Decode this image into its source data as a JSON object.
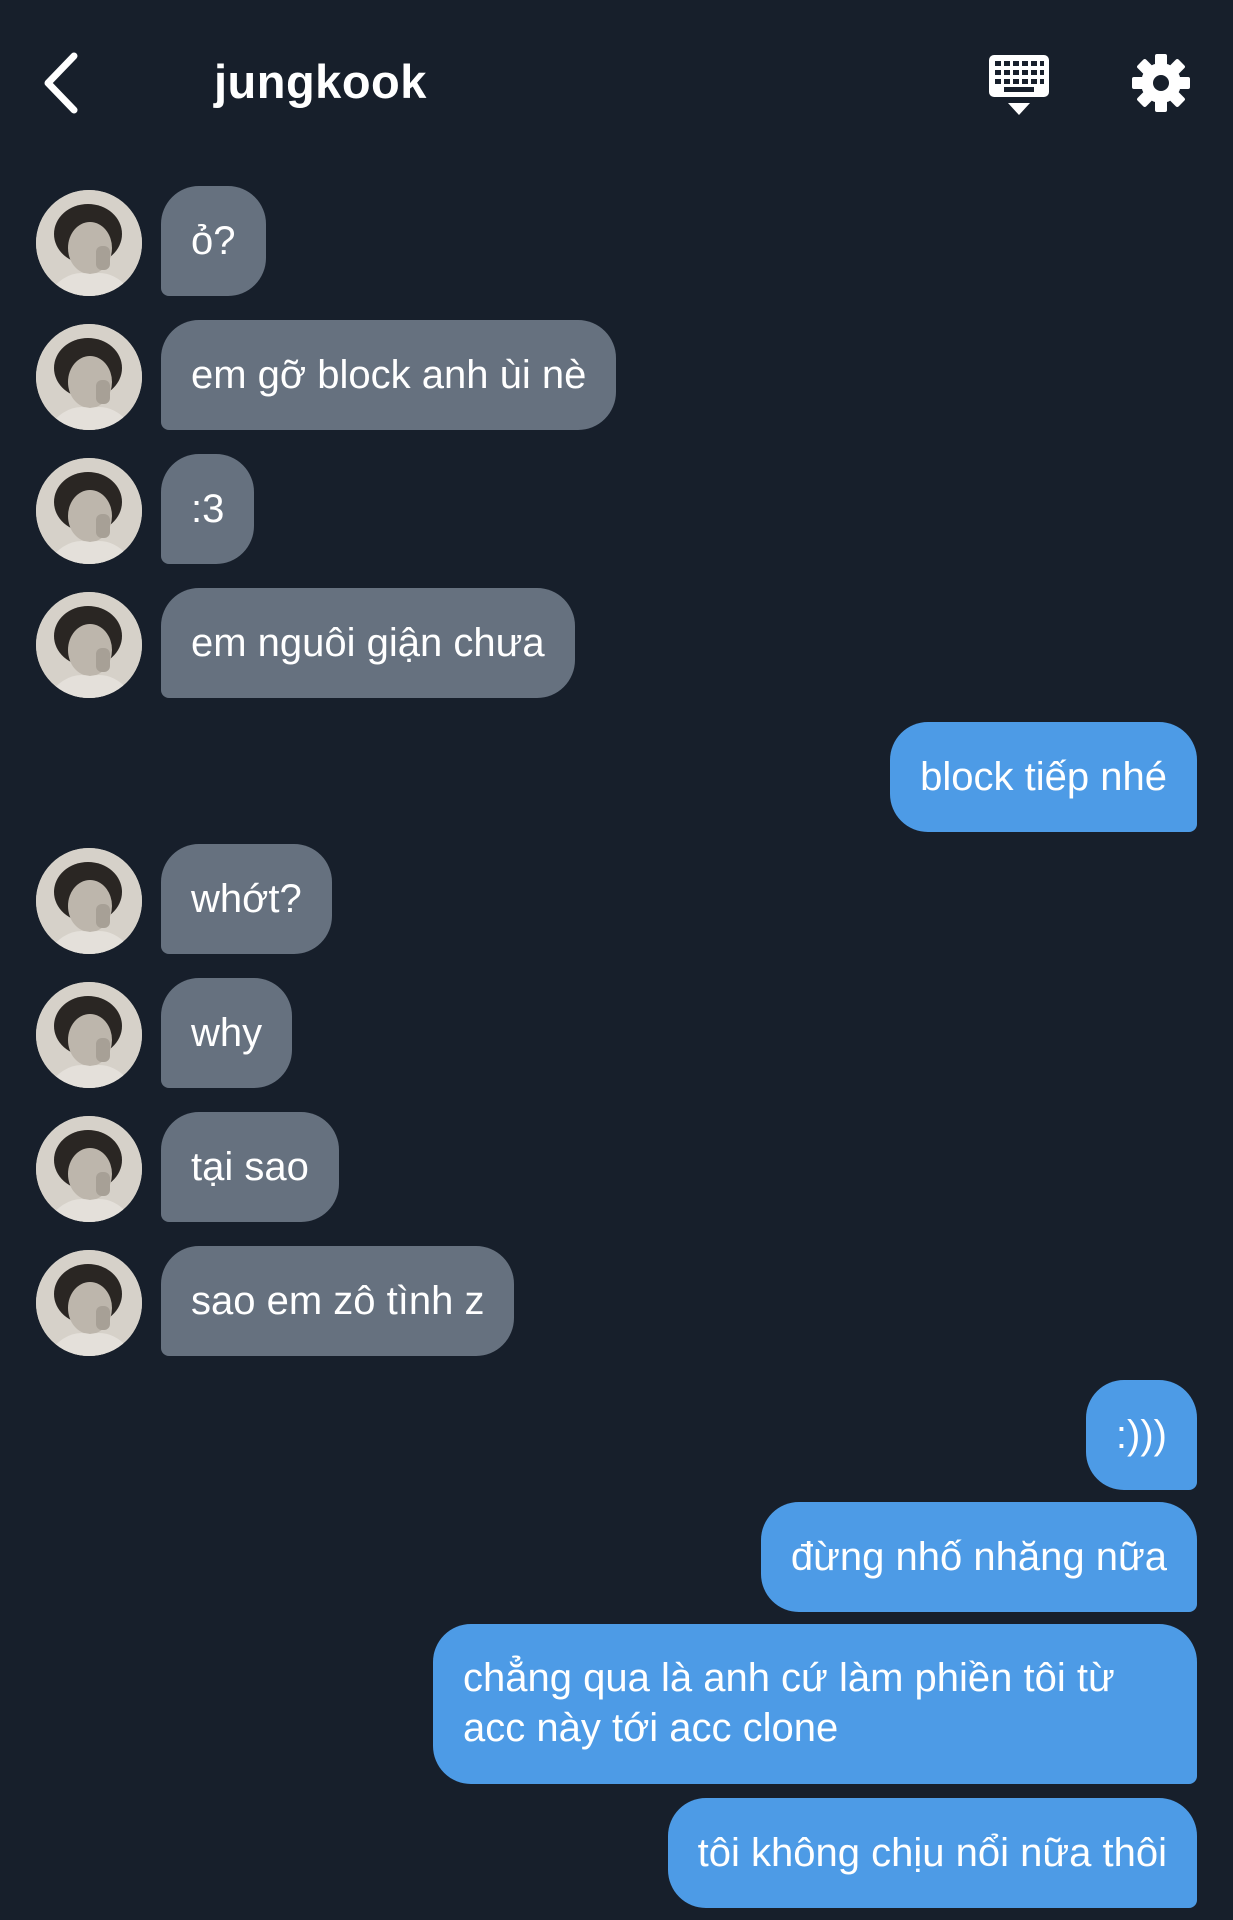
{
  "header": {
    "title": "jungkook"
  },
  "messages": [
    {
      "side": "in",
      "text": "ỏ?"
    },
    {
      "side": "in",
      "text": "em gỡ block anh ùi nè"
    },
    {
      "side": "in",
      "text": ":3"
    },
    {
      "side": "in",
      "text": "em nguôi giận chưa"
    },
    {
      "side": "out",
      "text": "block tiếp nhé"
    },
    {
      "side": "in",
      "text": "whớt?"
    },
    {
      "side": "in",
      "text": "why"
    },
    {
      "side": "in",
      "text": "tại sao"
    },
    {
      "side": "in",
      "text": "sao em zô tình z"
    },
    {
      "side": "out",
      "text": ":)))"
    },
    {
      "side": "out",
      "text": "đừng nhố nhăng nữa"
    },
    {
      "side": "out",
      "text": "chẳng qua là anh cứ làm phiền tôi từ acc này tới acc clone"
    },
    {
      "side": "out",
      "text": "tôi không chịu nổi nữa thôi"
    }
  ],
  "colors": {
    "background": "#171f2b",
    "incoming_bubble": "#66717f",
    "outgoing_bubble": "#4d9be6",
    "text": "#ffffff"
  },
  "icons": {
    "back": "chevron-left-icon",
    "keyboard": "keyboard-icon",
    "settings": "gear-icon",
    "avatar": "avatar"
  }
}
